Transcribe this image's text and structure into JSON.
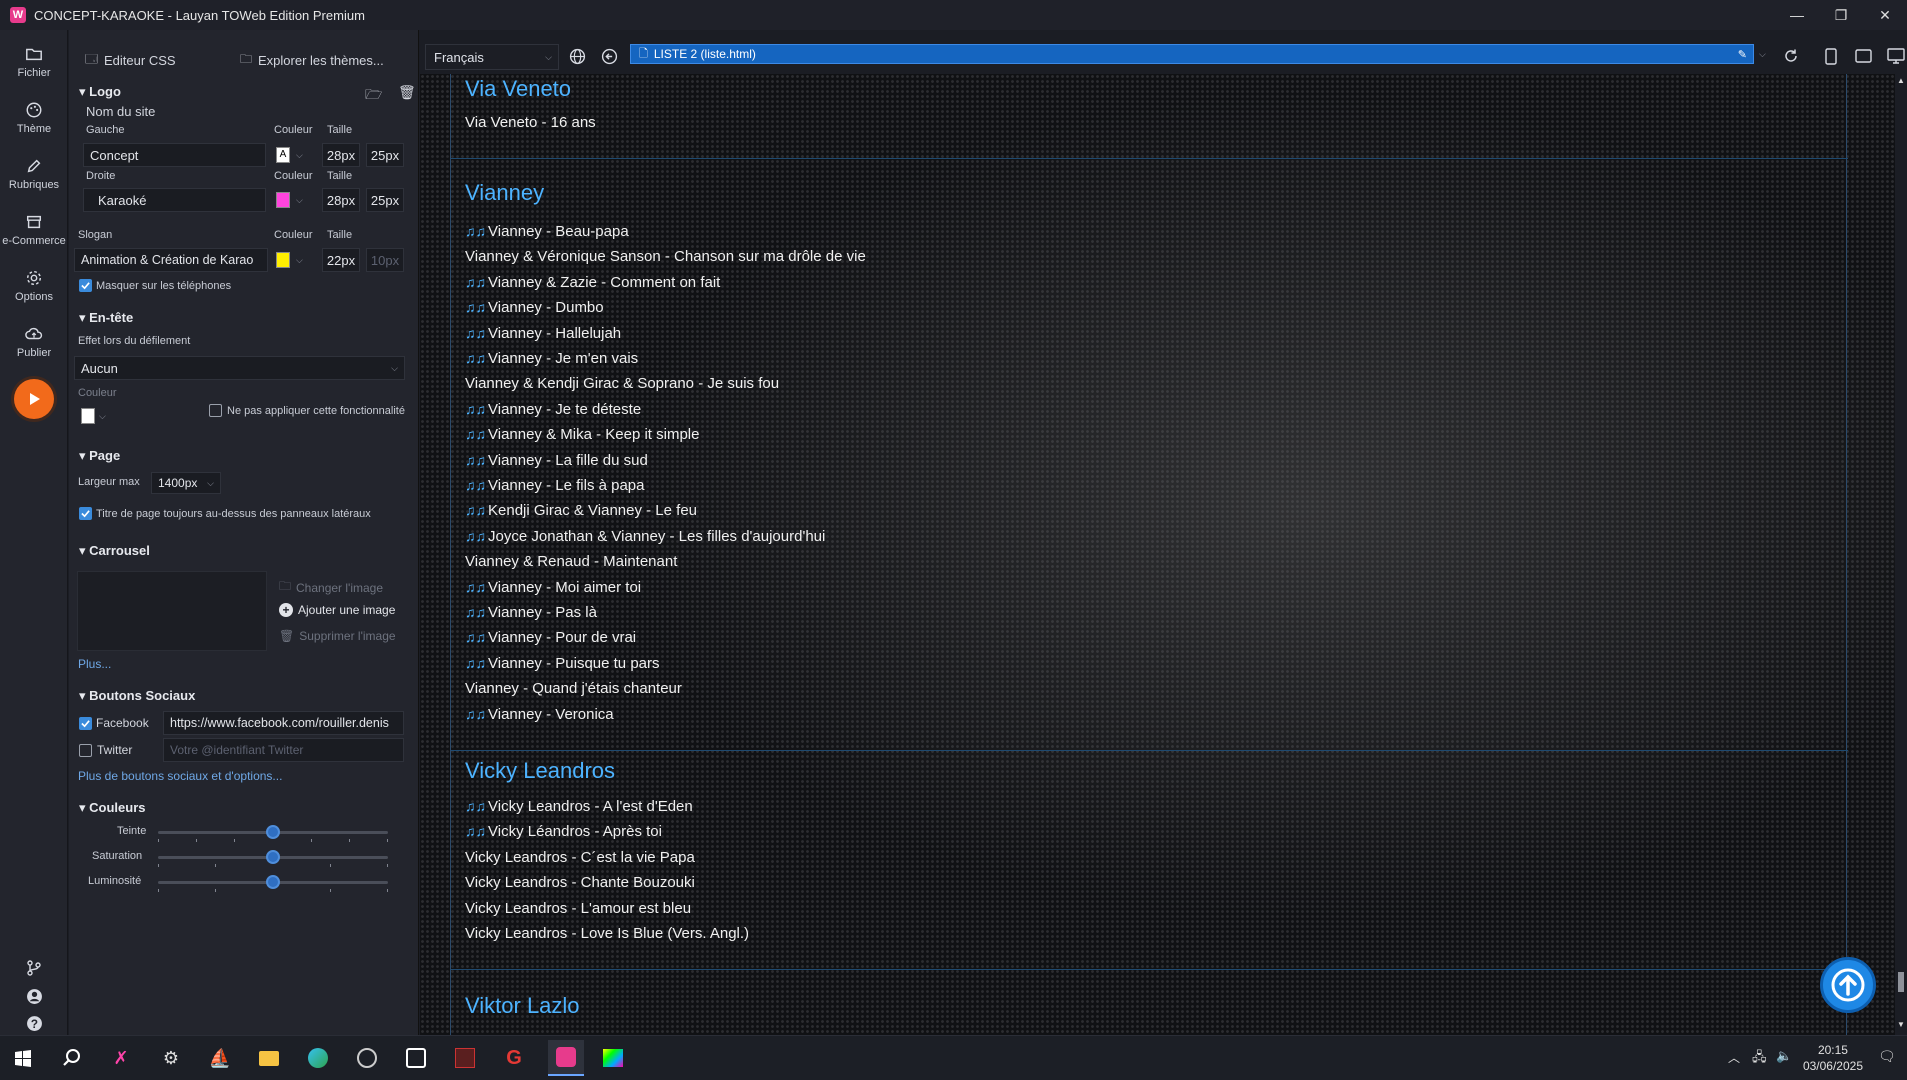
{
  "window": {
    "title": "CONCEPT-KARAOKE - Lauyan TOWeb Edition Premium",
    "logo_letter": "W"
  },
  "rail": {
    "items": [
      {
        "label": "Fichier",
        "icon": "folder-icon"
      },
      {
        "label": "Thème",
        "icon": "palette-icon"
      },
      {
        "label": "Rubriques",
        "icon": "pencil-icon"
      },
      {
        "label": "e-Commerce",
        "icon": "shop-icon"
      },
      {
        "label": "Options",
        "icon": "gear-icon"
      },
      {
        "label": "Publier",
        "icon": "cloud-upload-icon"
      }
    ]
  },
  "panel": {
    "css_editor": "Editeur CSS",
    "explore_themes": "Explorer les thèmes...",
    "logo": {
      "section": "Logo",
      "site_name": "Nom du site",
      "left_label": "Gauche",
      "right_label": "Droite",
      "color_label": "Couleur",
      "size_label": "Taille",
      "left_value": "Concept",
      "left_swatch_letter": "A",
      "left_size1": "28px",
      "left_size2": "25px",
      "right_value": "Karaoké",
      "right_color": "#ff44dd",
      "right_size1": "28px",
      "right_size2": "25px",
      "slogan_label": "Slogan",
      "slogan_value": "Animation & Création de Karao",
      "slogan_color": "#ffee00",
      "slogan_size1": "22px",
      "slogan_size2": "10px",
      "hide_phones": "Masquer sur les téléphones"
    },
    "header": {
      "section": "En-tête",
      "scroll_effect_label": "Effet lors du défilement",
      "scroll_effect_value": "Aucun",
      "color_label": "Couleur",
      "no_apply": "Ne pas appliquer cette fonctionnalité"
    },
    "page": {
      "section": "Page",
      "max_width_label": "Largeur max",
      "max_width_value": "1400px",
      "title_above": "Titre de page toujours au-dessus des panneaux latéraux"
    },
    "carousel": {
      "section": "Carrousel",
      "change_image": "Changer l'image",
      "add_image": "Ajouter une image",
      "delete_image": "Supprimer l'image",
      "more": "Plus..."
    },
    "social": {
      "section": "Boutons Sociaux",
      "facebook_label": "Facebook",
      "facebook_value": "https://www.facebook.com/rouiller.denis",
      "twitter_label": "Twitter",
      "twitter_placeholder": "Votre @identifiant Twitter",
      "more": "Plus de boutons sociaux et d'options..."
    },
    "colors": {
      "section": "Couleurs",
      "hue": "Teinte",
      "saturation": "Saturation",
      "luminosity": "Luminosité",
      "hue_level": 0.5,
      "saturation_level": 0.5,
      "luminosity_level": 0.5
    }
  },
  "toolbar": {
    "language": "Français",
    "url": "LISTE 2 (liste.html)"
  },
  "preview": {
    "note_glyph": "♫♫",
    "artists": [
      {
        "name": "Via Veneto",
        "songs": [
          {
            "title": "Via Veneto - 16 ans",
            "note": false
          }
        ]
      },
      {
        "name": "Vianney",
        "songs": [
          {
            "title": "Vianney - Beau-papa",
            "note": true
          },
          {
            "title": "Vianney & Véronique Sanson - Chanson sur ma drôle de vie",
            "note": false
          },
          {
            "title": "Vianney & Zazie - Comment on fait",
            "note": true
          },
          {
            "title": "Vianney - Dumbo",
            "note": true
          },
          {
            "title": "Vianney - Hallelujah",
            "note": true
          },
          {
            "title": "Vianney - Je m'en vais",
            "note": true
          },
          {
            "title": "Vianney & Kendji Girac & Soprano - Je suis fou",
            "note": false
          },
          {
            "title": "Vianney - Je te déteste",
            "note": true
          },
          {
            "title": "Vianney & Mika - Keep it simple",
            "note": true
          },
          {
            "title": "Vianney - La fille du sud",
            "note": true
          },
          {
            "title": "Vianney - Le fils à papa",
            "note": true
          },
          {
            "title": "Kendji Girac & Vianney - Le feu",
            "note": true
          },
          {
            "title": "Joyce Jonathan & Vianney - Les filles d'aujourd'hui",
            "note": true
          },
          {
            "title": "Vianney & Renaud - Maintenant",
            "note": false
          },
          {
            "title": "Vianney - Moi aimer toi",
            "note": true
          },
          {
            "title": "Vianney - Pas là",
            "note": true
          },
          {
            "title": "Vianney - Pour de vrai",
            "note": true
          },
          {
            "title": "Vianney - Puisque tu pars",
            "note": true
          },
          {
            "title": "Vianney - Quand j'étais chanteur",
            "note": false
          },
          {
            "title": "Vianney - Veronica",
            "note": true
          }
        ]
      },
      {
        "name": "Vicky Leandros",
        "songs": [
          {
            "title": "Vicky Leandros - A l'est d'Eden",
            "note": true
          },
          {
            "title": "Vicky Léandros - Après toi",
            "note": true
          },
          {
            "title": "Vicky Leandros - C´est la vie Papa",
            "note": false
          },
          {
            "title": "Vicky Leandros - Chante Bouzouki",
            "note": false
          },
          {
            "title": "Vicky Leandros - L'amour est bleu",
            "note": false
          },
          {
            "title": "Vicky Leandros - Love Is Blue (Vers. Angl.)",
            "note": false
          }
        ]
      },
      {
        "name": "Viktor Lazlo",
        "songs": []
      }
    ]
  },
  "taskbar": {
    "time": "20:15",
    "date": "03/06/2025"
  }
}
